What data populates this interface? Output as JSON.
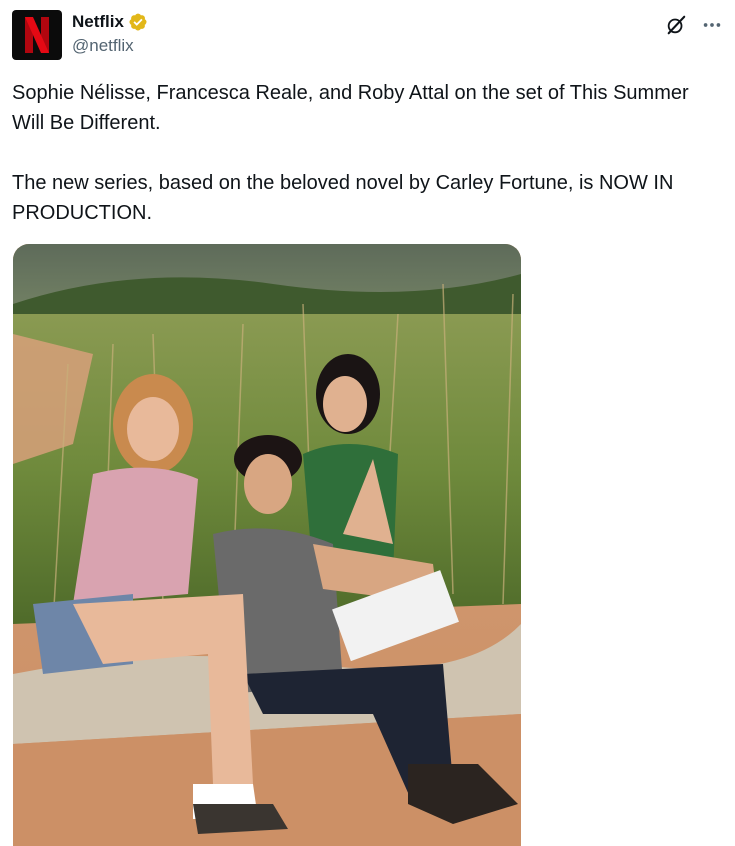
{
  "post": {
    "author": {
      "display_name": "Netflix",
      "handle": "@netflix",
      "verified": true,
      "avatar_letter": "N",
      "brand_color": "#e50914",
      "verified_color": "#e2b719"
    },
    "text": {
      "paragraph1": "Sophie Nélisse, Francesca Reale, and Roby Attal on the set of This Summer Will Be Different.",
      "paragraph2": "The new series, based on the beloved novel by Carley Fortune, is NOW IN PRODUCTION."
    },
    "actions": {
      "grok_icon": "grok-icon",
      "more_icon": "more-icon"
    },
    "media": {
      "icon": "photo"
    }
  }
}
